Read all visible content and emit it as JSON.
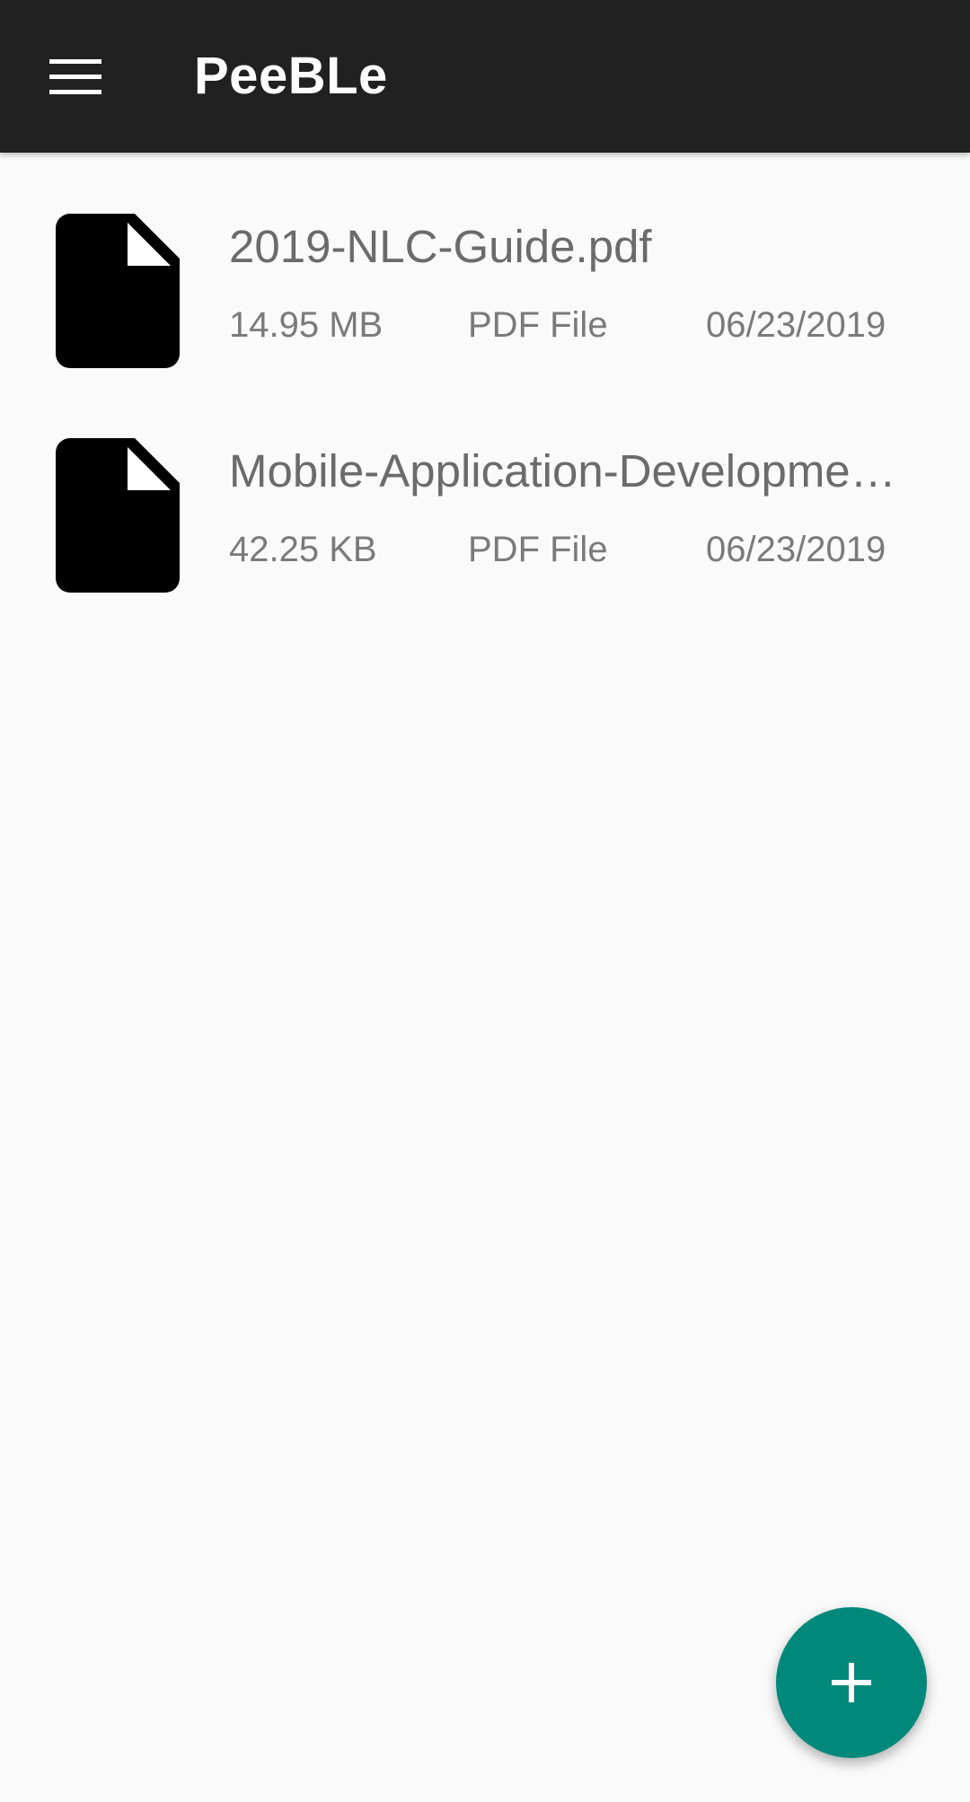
{
  "app_bar": {
    "title": "PeeBLe",
    "background_color": "#212121",
    "menu_icon": "hamburger-menu-icon"
  },
  "files": [
    {
      "name": "2019-NLC-Guide.pdf",
      "size": "14.95 MB",
      "type": "PDF File",
      "date": "06/23/2019",
      "icon": "document-icon"
    },
    {
      "name": "Mobile-Application-Developme…",
      "size": "42.25 KB",
      "type": "PDF File",
      "date": "06/23/2019",
      "icon": "document-icon"
    }
  ],
  "fab": {
    "icon": "plus-icon",
    "color": "#00897b"
  }
}
